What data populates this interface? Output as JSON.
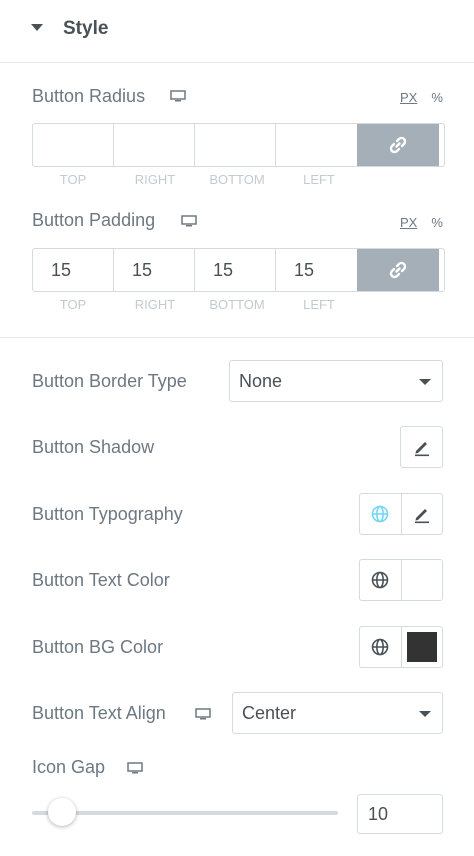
{
  "section": {
    "title": "Style"
  },
  "button_radius": {
    "label": "Button Radius",
    "units": [
      "PX",
      "%"
    ],
    "values": [
      "",
      "",
      "",
      ""
    ],
    "sides": [
      "TOP",
      "RIGHT",
      "BOTTOM",
      "LEFT"
    ]
  },
  "button_padding": {
    "label": "Button Padding",
    "units": [
      "PX",
      "%"
    ],
    "values": [
      "15",
      "15",
      "15",
      "15"
    ],
    "sides": [
      "TOP",
      "RIGHT",
      "BOTTOM",
      "LEFT"
    ]
  },
  "border_type": {
    "label": "Button Border Type",
    "selected": "None"
  },
  "shadow": {
    "label": "Button Shadow"
  },
  "typography": {
    "label": "Button Typography"
  },
  "text_color": {
    "label": "Button Text Color",
    "swatch_color": "#ffffff"
  },
  "bg_color": {
    "label": "Button BG Color",
    "swatch_color": "#333333"
  },
  "text_align": {
    "label": "Button Text Align",
    "selected": "Center"
  },
  "icon_gap": {
    "label": "Icon Gap",
    "value": "10",
    "slider_fraction": 0.1
  },
  "colors": {
    "link_button_bg": "#a4afb7",
    "globe_active": "#71d7f7",
    "text": "#6d7882"
  }
}
